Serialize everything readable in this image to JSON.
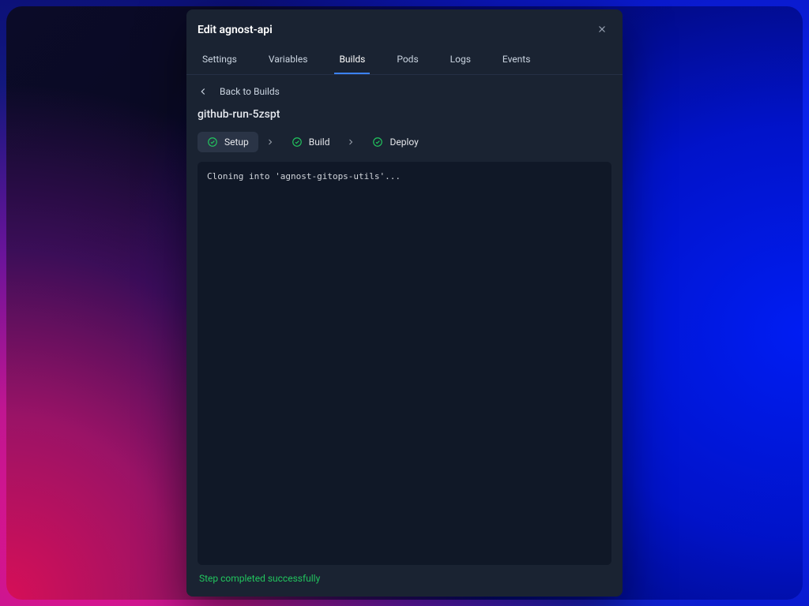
{
  "header": {
    "title": "Edit agnost-api"
  },
  "tabs": [
    {
      "label": "Settings",
      "active": false
    },
    {
      "label": "Variables",
      "active": false
    },
    {
      "label": "Builds",
      "active": true
    },
    {
      "label": "Pods",
      "active": false
    },
    {
      "label": "Logs",
      "active": false
    },
    {
      "label": "Events",
      "active": false
    }
  ],
  "back": {
    "label": "Back to Builds"
  },
  "run": {
    "title": "github-run-5zspt"
  },
  "steps": [
    {
      "label": "Setup",
      "status": "success",
      "active": true,
      "icon": "check-circle-icon"
    },
    {
      "label": "Build",
      "status": "success",
      "active": false,
      "icon": "check-circle-icon"
    },
    {
      "label": "Deploy",
      "status": "success",
      "active": false,
      "icon": "check-circle-icon"
    }
  ],
  "log": {
    "content": "Cloning into 'agnost-gitops-utils'..."
  },
  "footer": {
    "status": "Step completed successfully"
  },
  "colors": {
    "accent": "#3b82f6",
    "success": "#22c55e"
  }
}
